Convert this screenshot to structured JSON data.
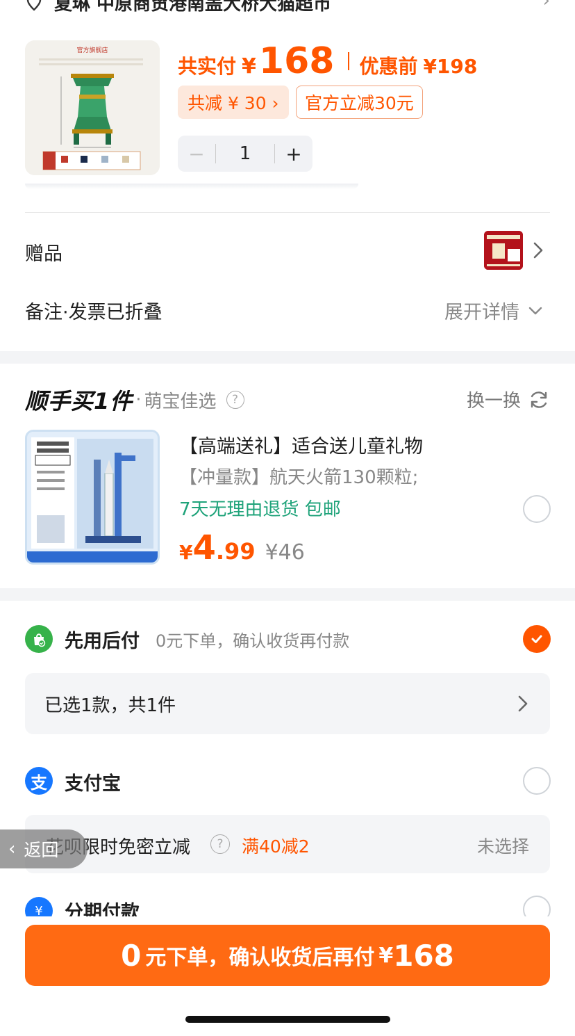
{
  "address": {
    "text": "夏琳 中原商贸港南盖大桥大猫超市"
  },
  "product": {
    "pay_label": "共实付",
    "currency": "¥",
    "pay_amount": "168",
    "pre_label": "优惠前",
    "pre_price": "¥198",
    "discount_chip": "共减 ¥ 30 ›",
    "official_chip": "官方立减30元",
    "qty_minus": "−",
    "quantity": "1",
    "qty_plus": "+",
    "image_store_label": "官方旗舰店"
  },
  "gift": {
    "label": "赠品"
  },
  "notes": {
    "label": "备注·发票已折叠",
    "expand": "展开详情"
  },
  "upsell": {
    "title": "顺手买1件",
    "dot": "·",
    "subtitle": "萌宝佳选",
    "help": "?",
    "swap": "换一换",
    "name": "【高端送礼】适合送儿童礼物",
    "desc": "【冲量款】航天火箭130颗粒;",
    "tags": "7天无理由退货  包邮",
    "price_currency": "¥",
    "price_int": "4",
    "price_dec": ".99",
    "orig_price": "¥46"
  },
  "payment": {
    "option1_label": "先用后付",
    "option1_desc": "0元下单，确认收货再付款",
    "selected_summary": "已选1款，共1件",
    "option2_label": "支付宝",
    "option2_icon_glyph": "支",
    "huabei_label": "花呗限时免密立减",
    "huabei_help": "?",
    "huabei_promo": "满40减2",
    "huabei_status": "未选择",
    "option3_label": "分期付款",
    "option3_icon_glyph": "¥"
  },
  "back": {
    "label": "返回"
  },
  "cta": {
    "zero": "0",
    "text": "元下单，确认收货后再付",
    "currency": "¥",
    "amount": "168"
  },
  "colors": {
    "accent": "#ff5500",
    "cta": "#ff6a13",
    "green": "#36b24a",
    "alipay": "#1677ff"
  }
}
